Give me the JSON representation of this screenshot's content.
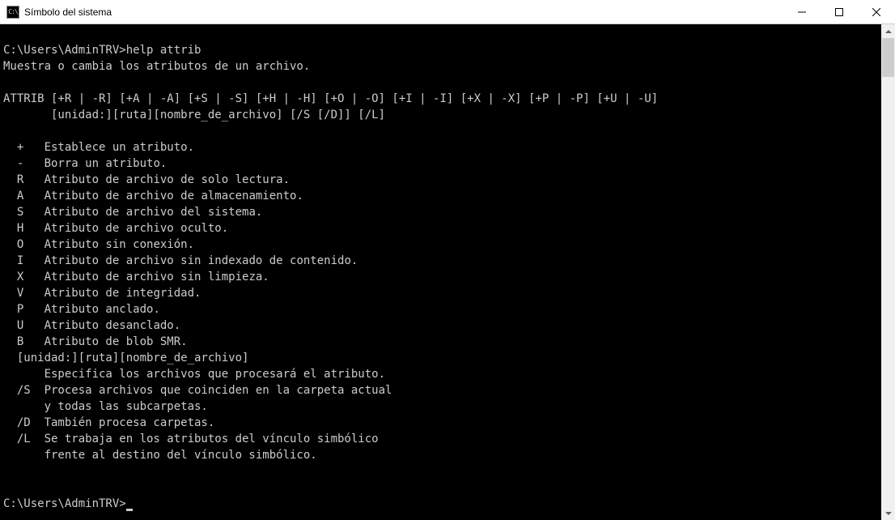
{
  "window": {
    "title": "Símbolo del sistema",
    "icon_label": "CMD"
  },
  "prompt": "C:\\Users\\AdminTRV>",
  "command": "help attrib",
  "output": {
    "description": "Muestra o cambia los atributos de un archivo.",
    "syntax_line1": "ATTRIB [+R | -R] [+A | -A] [+S | -S] [+H | -H] [+O | -O] [+I | -I] [+X | -X] [+P | -P] [+U | -U]",
    "syntax_line2": "       [unidad:][ruta][nombre_de_archivo] [/S [/D]] [/L]",
    "params": [
      {
        "flag": "  +   ",
        "desc": "Establece un atributo."
      },
      {
        "flag": "  -   ",
        "desc": "Borra un atributo."
      },
      {
        "flag": "  R   ",
        "desc": "Atributo de archivo de solo lectura."
      },
      {
        "flag": "  A   ",
        "desc": "Atributo de archivo de almacenamiento."
      },
      {
        "flag": "  S   ",
        "desc": "Atributo de archivo del sistema."
      },
      {
        "flag": "  H   ",
        "desc": "Atributo de archivo oculto."
      },
      {
        "flag": "  O   ",
        "desc": "Atributo sin conexión."
      },
      {
        "flag": "  I   ",
        "desc": "Atributo de archivo sin indexado de contenido."
      },
      {
        "flag": "  X   ",
        "desc": "Atributo de archivo sin limpieza."
      },
      {
        "flag": "  V   ",
        "desc": "Atributo de integridad."
      },
      {
        "flag": "  P   ",
        "desc": "Atributo anclado."
      },
      {
        "flag": "  U   ",
        "desc": "Atributo desanclado."
      },
      {
        "flag": "  B   ",
        "desc": "Atributo de blob SMR."
      }
    ],
    "path_header": "  [unidad:][ruta][nombre_de_archivo]",
    "path_desc": "      Especifica los archivos que procesará el atributo.",
    "s_line1": "  /S  Procesa archivos que coinciden en la carpeta actual",
    "s_line2": "      y todas las subcarpetas.",
    "d_line": "  /D  También procesa carpetas.",
    "l_line1": "  /L  Se trabaja en los atributos del vínculo simbólico",
    "l_line2": "      frente al destino del vínculo simbólico."
  },
  "prompt2": "C:\\Users\\AdminTRV>"
}
